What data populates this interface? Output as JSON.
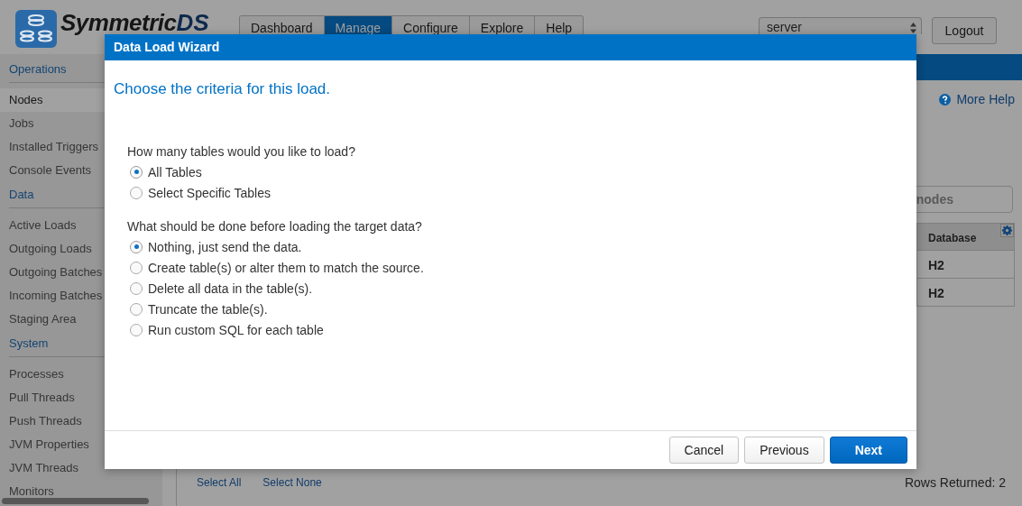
{
  "header": {
    "logo_text": "Symmetric",
    "logo_suffix": "DS",
    "tabs": [
      {
        "label": "Dashboard",
        "selected": false
      },
      {
        "label": "Manage",
        "selected": true
      },
      {
        "label": "Configure",
        "selected": false
      },
      {
        "label": "Explore",
        "selected": false
      },
      {
        "label": "Help",
        "selected": false
      }
    ],
    "node_select": "server",
    "logout": "Logout"
  },
  "sidebar": {
    "sections": [
      {
        "title": "Operations",
        "items": [
          {
            "label": "Nodes",
            "selected": true
          },
          {
            "label": "Jobs",
            "selected": false
          },
          {
            "label": "Installed Triggers",
            "selected": false
          },
          {
            "label": "Console Events",
            "selected": false
          }
        ]
      },
      {
        "title": "Data",
        "items": [
          {
            "label": "Active Loads",
            "selected": false
          },
          {
            "label": "Outgoing Loads",
            "selected": false
          },
          {
            "label": "Outgoing Batches",
            "selected": false
          },
          {
            "label": "Incoming Batches",
            "selected": false
          },
          {
            "label": "Staging Area",
            "selected": false
          }
        ]
      },
      {
        "title": "System",
        "items": [
          {
            "label": "Processes",
            "selected": false
          },
          {
            "label": "Pull Threads",
            "selected": false
          },
          {
            "label": "Push Threads",
            "selected": false
          },
          {
            "label": "JVM Properties",
            "selected": false
          },
          {
            "label": "JVM Threads",
            "selected": false
          },
          {
            "label": "Monitors",
            "selected": false
          }
        ]
      }
    ]
  },
  "main": {
    "more_help": "More Help",
    "filter": {
      "placeholder": "nodes"
    },
    "table": {
      "columns": [
        "Database"
      ],
      "rows": [
        [
          "H2"
        ],
        [
          "H2"
        ]
      ]
    },
    "footer_links": [
      "Select All",
      "Select None"
    ],
    "rows_returned": "Rows Returned: 2"
  },
  "dialog": {
    "title": "Data Load Wizard",
    "heading": "Choose the criteria for this load.",
    "questions": [
      {
        "text": "How many tables would you like to load?",
        "options": [
          {
            "label": "All Tables",
            "selected": true
          },
          {
            "label": "Select Specific Tables",
            "selected": false
          }
        ]
      },
      {
        "text": "What should be done before loading the target data?",
        "options": [
          {
            "label": "Nothing, just send the data.",
            "selected": true
          },
          {
            "label": "Create table(s) or alter them to match the source.",
            "selected": false
          },
          {
            "label": "Delete all data in the table(s).",
            "selected": false
          },
          {
            "label": "Truncate the table(s).",
            "selected": false
          },
          {
            "label": "Run custom SQL for each table",
            "selected": false
          }
        ]
      }
    ],
    "buttons": [
      {
        "label": "Cancel",
        "kind": "default"
      },
      {
        "label": "Previous",
        "kind": "default"
      },
      {
        "label": "Next",
        "kind": "primary"
      }
    ]
  }
}
